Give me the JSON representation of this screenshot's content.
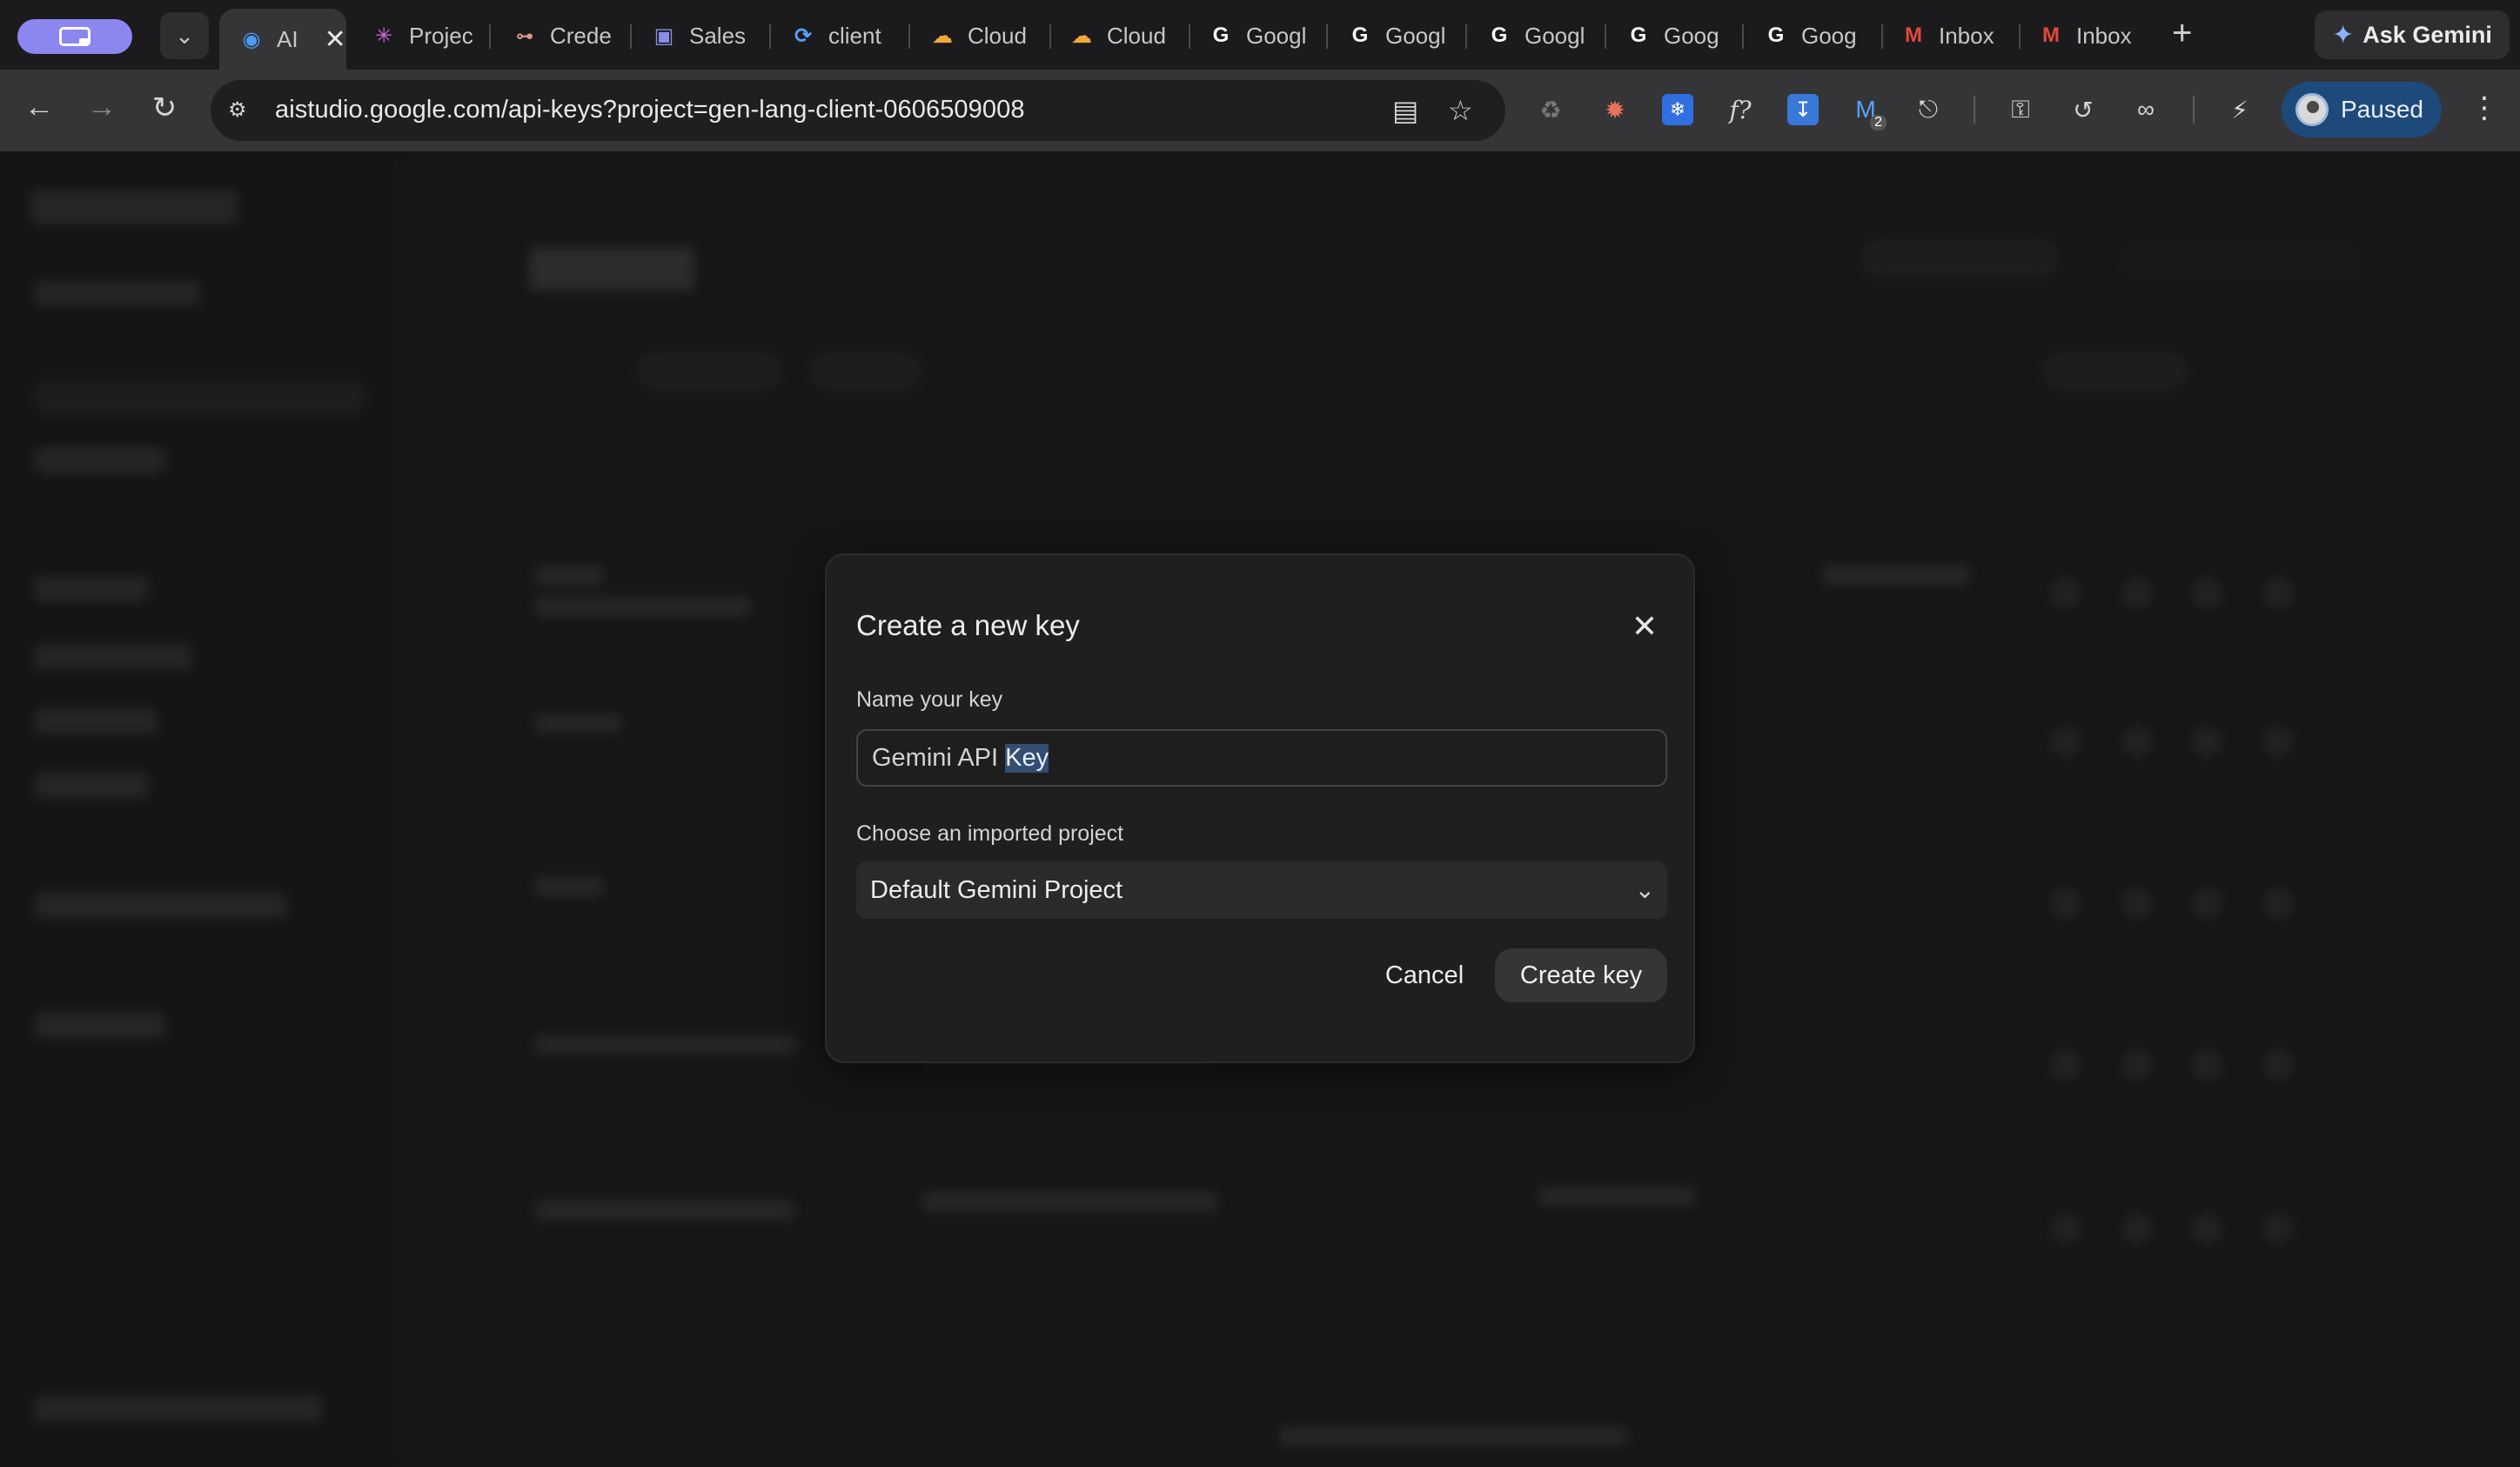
{
  "browser": {
    "tabs": [
      {
        "title": "AI",
        "favicon": "ai-studio-icon",
        "active": true
      },
      {
        "title": "Projec",
        "favicon": "sparkle-icon"
      },
      {
        "title": "Crede",
        "favicon": "key-network-icon"
      },
      {
        "title": "Sales",
        "favicon": "salesforce-icon"
      },
      {
        "title": "client",
        "favicon": "loading-ring-icon"
      },
      {
        "title": "Cloud",
        "favicon": "google-cloud-icon"
      },
      {
        "title": "Cloud",
        "favicon": "google-cloud-icon"
      },
      {
        "title": "Googl",
        "favicon": "google-g-icon"
      },
      {
        "title": "Googl",
        "favicon": "google-g-icon"
      },
      {
        "title": "Googl",
        "favicon": "google-g-icon"
      },
      {
        "title": "Goog",
        "favicon": "google-g-icon"
      },
      {
        "title": "Goog",
        "favicon": "google-g-icon"
      },
      {
        "title": "Inbox",
        "favicon": "gmail-icon"
      },
      {
        "title": "Inbox",
        "favicon": "gmail-icon"
      }
    ],
    "url": "aistudio.google.com/api-keys?project=gen-lang-client-0606509008",
    "ask_gemini_label": "Ask Gemini",
    "profile_status": "Paused",
    "extension_badge": "2"
  },
  "dialog": {
    "title": "Create a new key",
    "name_label": "Name your key",
    "name_value_plain": "Gemini API ",
    "name_value_selected": "Key",
    "project_label": "Choose an imported project",
    "project_value": "Default Gemini Project",
    "cancel_label": "Cancel",
    "create_label": "Create key"
  },
  "colors": {
    "accent_blue": "#8ab4f8",
    "selection": "#334d73",
    "space_pill": "#8b86f0",
    "profile_pill": "#1d4a7a"
  }
}
